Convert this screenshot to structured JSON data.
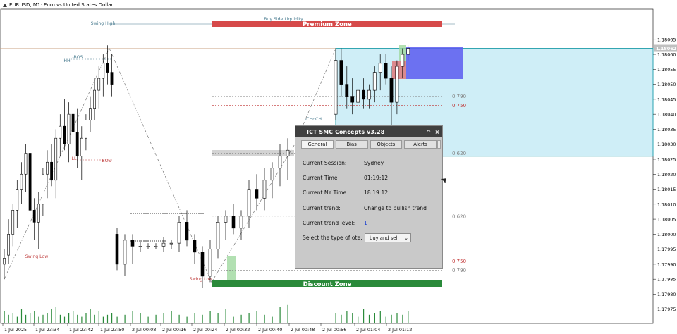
{
  "header": {
    "title": "EURUSD, M1:  Euro vs United States Dollar"
  },
  "colors": {
    "bull_body": "#ffffff",
    "bear_body": "#000000",
    "wick": "#000000",
    "premium": "#d64a4a",
    "discount": "#2a8a3a",
    "zone_fill": "#cfeef7",
    "zone_border": "#2aa3b0",
    "ob_blue": "#5b5bf0",
    "ob_red": "#e06060",
    "fvg_green": "#9fd89f",
    "level_red": "#c03030"
  },
  "chart_data": {
    "type": "candlestick",
    "symbol": "EURUSD",
    "timeframe": "M1",
    "ylim": [
      1.1797,
      1.18072
    ],
    "y_ticks": [
      "1.18065",
      "1.18060",
      "1.18055",
      "1.18050",
      "1.18045",
      "1.18040",
      "1.18035",
      "1.18030",
      "1.18025",
      "1.18020",
      "1.18015",
      "1.18010",
      "1.18005",
      "1.18000",
      "1.17995",
      "1.17990",
      "1.17985",
      "1.17980",
      "1.17975"
    ],
    "current_price": "1.18062",
    "x_ticks": [
      "1 Jul 2025",
      "1 Jul 23:34",
      "1 Jul 23:42",
      "1 Jul 23:50",
      "2 Jul 00:08",
      "2 Jul 00:16",
      "2 Jul 00:24",
      "2 Jul 00:32",
      "2 Jul 00:40",
      "2 Jul 00:48",
      "2 Jul 00:56",
      "2 Jul 01:04",
      "2 Jul 01:12"
    ],
    "candles": [
      {
        "i": 0,
        "o": 1.1799,
        "h": 1.17995,
        "l": 1.17985,
        "c": 1.17992
      },
      {
        "i": 1,
        "o": 1.17993,
        "h": 1.18005,
        "l": 1.1799,
        "c": 1.18
      },
      {
        "i": 2,
        "o": 1.18,
        "h": 1.1801,
        "l": 1.17996,
        "c": 1.18008
      },
      {
        "i": 3,
        "o": 1.18008,
        "h": 1.18018,
        "l": 1.18002,
        "c": 1.18015
      },
      {
        "i": 4,
        "o": 1.18015,
        "h": 1.18024,
        "l": 1.1801,
        "c": 1.1802
      },
      {
        "i": 5,
        "o": 1.1802,
        "h": 1.1803,
        "l": 1.18014,
        "c": 1.18027
      },
      {
        "i": 6,
        "o": 1.18027,
        "h": 1.18032,
        "l": 1.18005,
        "c": 1.18008
      },
      {
        "i": 7,
        "o": 1.18008,
        "h": 1.18012,
        "l": 1.17998,
        "c": 1.18004
      },
      {
        "i": 8,
        "o": 1.18004,
        "h": 1.18014,
        "l": 1.17995,
        "c": 1.1801
      },
      {
        "i": 9,
        "o": 1.1801,
        "h": 1.18022,
        "l": 1.18006,
        "c": 1.1802
      },
      {
        "i": 10,
        "o": 1.1802,
        "h": 1.18028,
        "l": 1.18012,
        "c": 1.18024
      },
      {
        "i": 11,
        "o": 1.18024,
        "h": 1.1803,
        "l": 1.18016,
        "c": 1.18018
      },
      {
        "i": 12,
        "o": 1.18018,
        "h": 1.18035,
        "l": 1.18012,
        "c": 1.18032
      },
      {
        "i": 13,
        "o": 1.18032,
        "h": 1.1804,
        "l": 1.18026,
        "c": 1.18036
      },
      {
        "i": 14,
        "o": 1.18036,
        "h": 1.18045,
        "l": 1.18028,
        "c": 1.1803
      },
      {
        "i": 15,
        "o": 1.1803,
        "h": 1.18044,
        "l": 1.18024,
        "c": 1.1804
      },
      {
        "i": 16,
        "o": 1.1804,
        "h": 1.18048,
        "l": 1.1803,
        "c": 1.18034
      },
      {
        "i": 17,
        "o": 1.18034,
        "h": 1.18042,
        "l": 1.18022,
        "c": 1.18026
      },
      {
        "i": 18,
        "o": 1.18026,
        "h": 1.18036,
        "l": 1.18018,
        "c": 1.18032
      },
      {
        "i": 19,
        "o": 1.18032,
        "h": 1.1804,
        "l": 1.18028,
        "c": 1.18038
      },
      {
        "i": 20,
        "o": 1.18038,
        "h": 1.18046,
        "l": 1.18034,
        "c": 1.18042
      },
      {
        "i": 21,
        "o": 1.18042,
        "h": 1.18052,
        "l": 1.18038,
        "c": 1.18048
      },
      {
        "i": 22,
        "o": 1.18048,
        "h": 1.18056,
        "l": 1.18042,
        "c": 1.18052
      },
      {
        "i": 23,
        "o": 1.18052,
        "h": 1.1806,
        "l": 1.18046,
        "c": 1.18057
      },
      {
        "i": 24,
        "o": 1.18057,
        "h": 1.18063,
        "l": 1.1805,
        "c": 1.18054
      },
      {
        "i": 25,
        "o": 1.18054,
        "h": 1.1806,
        "l": 1.18046,
        "c": 1.1805
      },
      {
        "i": 26,
        "o": 1.18,
        "h": 1.18002,
        "l": 1.17988,
        "c": 1.1799
      },
      {
        "i": 27,
        "o": 1.1799,
        "h": 1.18,
        "l": 1.17986,
        "c": 1.17998
      },
      {
        "i": 28,
        "o": 1.17998,
        "h": 1.18,
        "l": 1.1799,
        "c": 1.17996
      },
      {
        "i": 29,
        "o": 1.17996,
        "h": 1.17998,
        "l": 1.17994,
        "c": 1.17996
      },
      {
        "i": 30,
        "o": 1.17996,
        "h": 1.17997,
        "l": 1.17995,
        "c": 1.17996
      },
      {
        "i": 31,
        "o": 1.17996,
        "h": 1.17997,
        "l": 1.17995,
        "c": 1.17996
      },
      {
        "i": 32,
        "o": 1.17996,
        "h": 1.17999,
        "l": 1.17994,
        "c": 1.17997
      },
      {
        "i": 33,
        "o": 1.17997,
        "h": 1.17998,
        "l": 1.17995,
        "c": 1.17997
      },
      {
        "i": 34,
        "o": 1.17997,
        "h": 1.18006,
        "l": 1.17994,
        "c": 1.18004
      },
      {
        "i": 35,
        "o": 1.18004,
        "h": 1.18008,
        "l": 1.17996,
        "c": 1.17998
      },
      {
        "i": 36,
        "o": 1.17998,
        "h": 1.18,
        "l": 1.1799,
        "c": 1.17994
      },
      {
        "i": 37,
        "o": 1.17994,
        "h": 1.17996,
        "l": 1.17982,
        "c": 1.17986
      },
      {
        "i": 38,
        "o": 1.17986,
        "h": 1.17998,
        "l": 1.17984,
        "c": 1.17995
      },
      {
        "i": 39,
        "o": 1.17995,
        "h": 1.18006,
        "l": 1.17992,
        "c": 1.18004
      },
      {
        "i": 40,
        "o": 1.18004,
        "h": 1.18008,
        "l": 1.17998,
        "c": 1.18006
      },
      {
        "i": 41,
        "o": 1.18006,
        "h": 1.1801,
        "l": 1.18,
        "c": 1.18002
      },
      {
        "i": 42,
        "o": 1.18002,
        "h": 1.18008,
        "l": 1.17998,
        "c": 1.18006
      },
      {
        "i": 43,
        "o": 1.18006,
        "h": 1.18018,
        "l": 1.18002,
        "c": 1.18015
      },
      {
        "i": 44,
        "o": 1.18015,
        "h": 1.1802,
        "l": 1.18008,
        "c": 1.18012
      },
      {
        "i": 45,
        "o": 1.18012,
        "h": 1.18022,
        "l": 1.18008,
        "c": 1.18018
      },
      {
        "i": 46,
        "o": 1.18018,
        "h": 1.18024,
        "l": 1.18012,
        "c": 1.18022
      },
      {
        "i": 47,
        "o": 1.18022,
        "h": 1.1803,
        "l": 1.18016,
        "c": 1.18026
      },
      {
        "i": 48,
        "o": 1.18026,
        "h": 1.18032,
        "l": 1.18018,
        "c": 1.18028
      },
      {
        "i": 49,
        "o": 1.1804,
        "h": 1.18062,
        "l": 1.18038,
        "c": 1.18058
      },
      {
        "i": 50,
        "o": 1.18058,
        "h": 1.18062,
        "l": 1.18046,
        "c": 1.1805
      },
      {
        "i": 51,
        "o": 1.1805,
        "h": 1.18056,
        "l": 1.18042,
        "c": 1.18046
      },
      {
        "i": 52,
        "o": 1.18046,
        "h": 1.18052,
        "l": 1.1804,
        "c": 1.18044
      },
      {
        "i": 53,
        "o": 1.18044,
        "h": 1.1805,
        "l": 1.1804,
        "c": 1.18048
      },
      {
        "i": 54,
        "o": 1.18048,
        "h": 1.18052,
        "l": 1.18042,
        "c": 1.18045
      },
      {
        "i": 55,
        "o": 1.18045,
        "h": 1.1805,
        "l": 1.18042,
        "c": 1.18048
      },
      {
        "i": 56,
        "o": 1.18048,
        "h": 1.18056,
        "l": 1.18044,
        "c": 1.18054
      },
      {
        "i": 57,
        "o": 1.18054,
        "h": 1.1806,
        "l": 1.18048,
        "c": 1.18057
      },
      {
        "i": 58,
        "o": 1.18057,
        "h": 1.1806,
        "l": 1.1805,
        "c": 1.18052
      },
      {
        "i": 59,
        "o": 1.18052,
        "h": 1.18056,
        "l": 1.18034,
        "c": 1.18044
      },
      {
        "i": 60,
        "o": 1.18044,
        "h": 1.18058,
        "l": 1.1804,
        "c": 1.18056
      },
      {
        "i": 61,
        "o": 1.18056,
        "h": 1.18062,
        "l": 1.18052,
        "c": 1.1806
      },
      {
        "i": 62,
        "o": 1.1806,
        "h": 1.18063,
        "l": 1.18058,
        "c": 1.18062
      }
    ],
    "levels": [
      {
        "label": "0.790",
        "price": 1.18046,
        "color": "#808080",
        "side": "top"
      },
      {
        "label": "0.750",
        "price": 1.18043,
        "color": "#c03030",
        "side": "top"
      },
      {
        "label": "0.620",
        "price": 1.18027,
        "color": "#808080",
        "side": "top"
      },
      {
        "label": "0.620",
        "price": 1.18006,
        "color": "#808080",
        "side": "bottom"
      },
      {
        "label": "0.750",
        "price": 1.17991,
        "color": "#c03030",
        "side": "bottom"
      },
      {
        "label": "0.790",
        "price": 1.17988,
        "color": "#808080",
        "side": "bottom"
      }
    ],
    "annotations": [
      {
        "text": "Swing High",
        "color": "#4a7c90"
      },
      {
        "text": "Swing Low",
        "color": "#c04040"
      },
      {
        "text": "Swing Low",
        "color": "#c04040"
      },
      {
        "text": "Buy Side Liquidity",
        "color": "#4a7c90"
      },
      {
        "text": "-BOS",
        "color": "#4a7c90"
      },
      {
        "text": "HH",
        "color": "#4a7c90"
      },
      {
        "text": "LL",
        "color": "#c04040"
      },
      {
        "text": "-BOS",
        "color": "#c04040"
      },
      {
        "text": "-CHoCH",
        "color": "#4a7c90"
      }
    ],
    "zones": {
      "premium_label": "Premium Zone",
      "discount_label": "Discount Zone"
    },
    "volume": [
      6,
      4,
      5,
      3,
      7,
      4,
      5,
      6,
      3,
      4,
      5,
      7,
      8,
      4,
      3,
      5,
      6,
      4,
      3,
      5,
      7,
      4,
      6,
      3,
      4,
      5,
      3,
      4,
      6,
      5,
      3,
      4,
      5,
      6,
      4,
      3,
      5,
      4,
      6,
      5,
      7,
      3,
      4,
      5,
      6,
      4,
      3,
      8,
      9,
      5,
      4,
      6,
      5,
      3,
      7,
      4,
      5,
      6,
      3,
      4,
      5,
      4,
      6
    ]
  },
  "panel": {
    "title": "ICT SMC Concepts v3.28",
    "minimize": "^",
    "close": "×",
    "tabs": [
      "General",
      "Bias",
      "Objects",
      "Alerts"
    ],
    "rows": [
      {
        "label": "Current Session:",
        "value": "Sydney"
      },
      {
        "label": "Current Time",
        "value": "01:19:12"
      },
      {
        "label": "Current NY Time:",
        "value": "18:19:12"
      },
      {
        "label": "Current trend:",
        "value": "Change to bullish trend"
      },
      {
        "label": "Current trend level:",
        "value": "1"
      }
    ],
    "ote_label": "Select the type of ote:",
    "ote_value": "buy and sell"
  }
}
